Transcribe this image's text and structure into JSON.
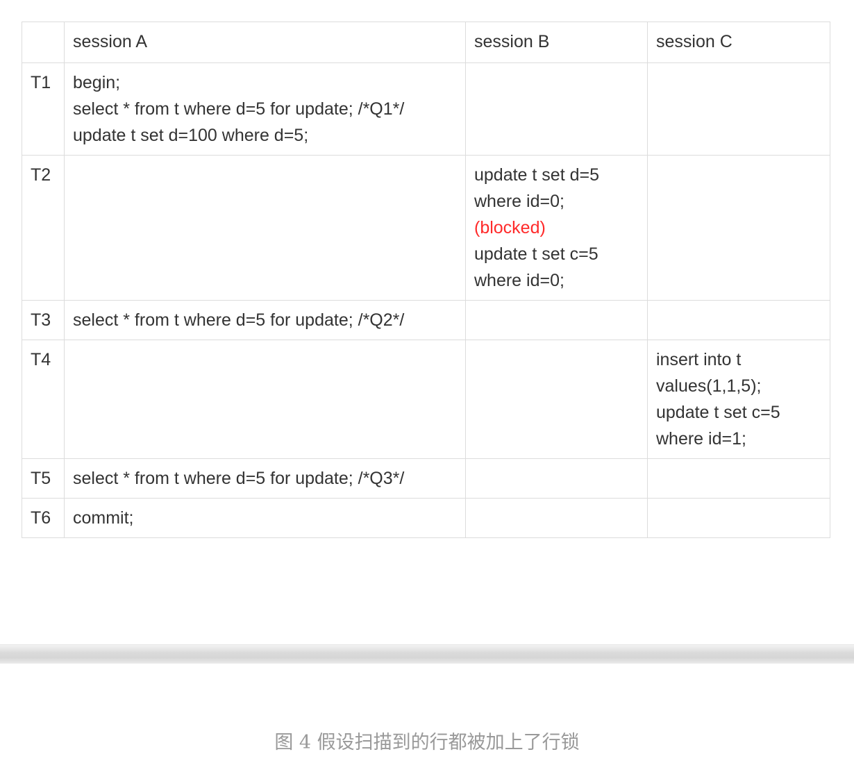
{
  "table": {
    "headers": [
      "",
      "session A",
      "session B",
      "session C"
    ],
    "rows": [
      {
        "time": "T1",
        "a": [
          "begin;",
          "select * from t where d=5 for update; /*Q1*/",
          "update t set d=100 where d=5;"
        ],
        "b": [],
        "c": []
      },
      {
        "time": "T2",
        "a": [],
        "b": [
          "update t set d=5",
          "where id=0;",
          "(blocked)",
          "update t set c=5",
          "where id=0;"
        ],
        "c": []
      },
      {
        "time": "T3",
        "a": [
          "select * from t where d=5 for update; /*Q2*/"
        ],
        "b": [],
        "c": []
      },
      {
        "time": "T4",
        "a": [],
        "b": [],
        "c": [
          "insert into t",
          "values(1,1,5);",
          "update t set c=5",
          "where id=1;"
        ]
      },
      {
        "time": "T5",
        "a": [
          "select * from t where d=5 for update; /*Q3*/"
        ],
        "b": [],
        "c": []
      },
      {
        "time": "T6",
        "a": [
          "commit;"
        ],
        "b": [],
        "c": []
      }
    ]
  },
  "colors": {
    "text": "#333333",
    "blocked": "#ff2a2a",
    "border": "#dcdcdc",
    "caption": "#999999"
  },
  "caption": "图 4 假设扫描到的行都被加上了行锁"
}
